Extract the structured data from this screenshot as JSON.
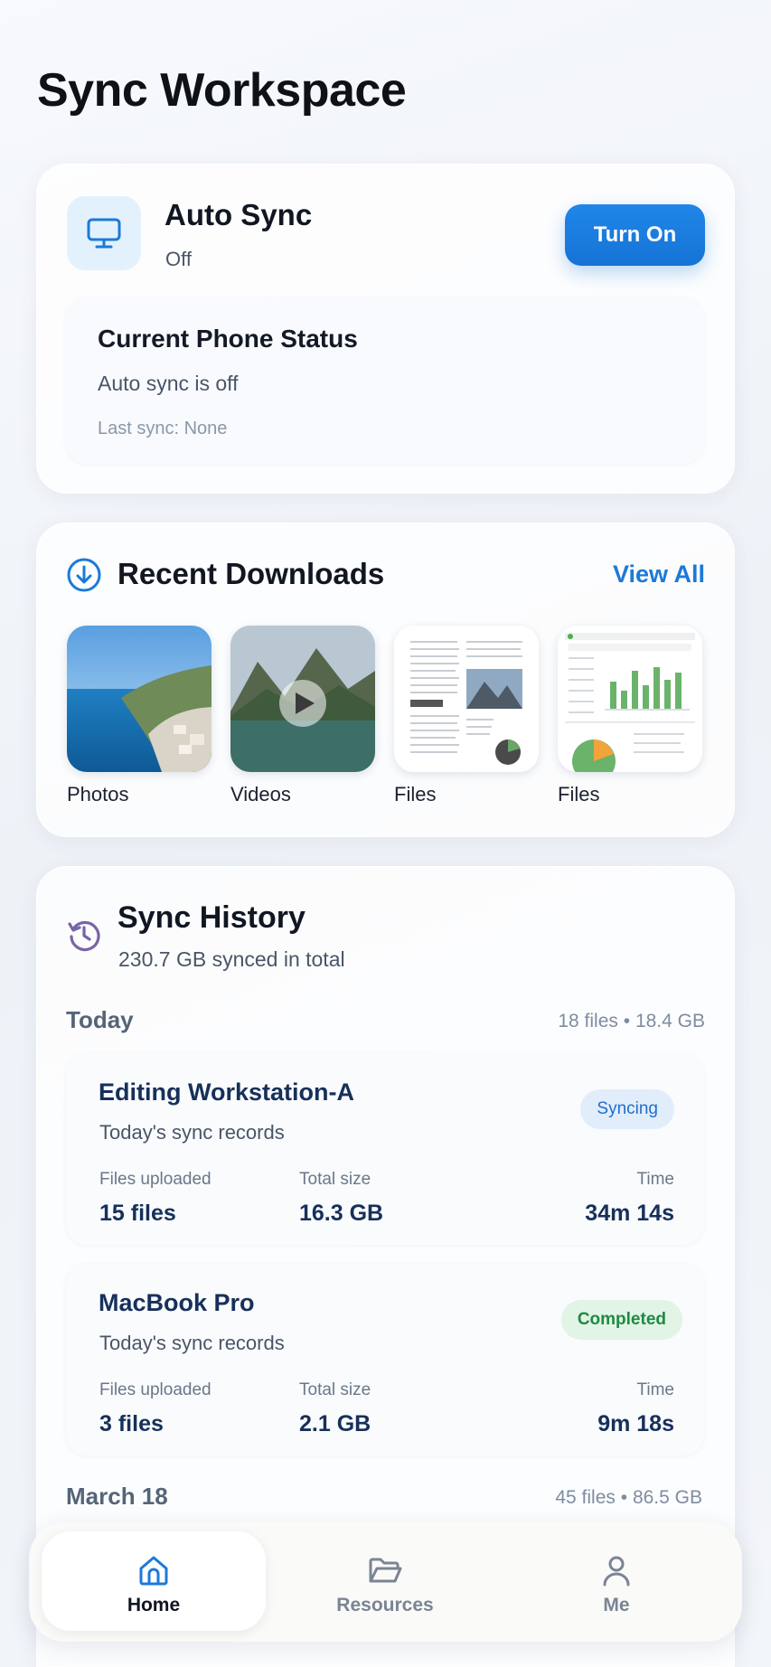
{
  "page": {
    "title": "Sync Workspace"
  },
  "auto_sync": {
    "title": "Auto Sync",
    "state": "Off",
    "button_label": "Turn On",
    "icon": "monitor-icon",
    "status": {
      "title": "Current Phone Status",
      "text": "Auto sync is off",
      "last_sync": "Last sync: None"
    }
  },
  "downloads": {
    "title": "Recent Downloads",
    "view_all": "View All",
    "items": [
      {
        "label": "Photos",
        "kind": "photo"
      },
      {
        "label": "Videos",
        "kind": "video"
      },
      {
        "label": "Files",
        "kind": "document"
      },
      {
        "label": "Files",
        "kind": "spreadsheet"
      }
    ]
  },
  "history": {
    "title": "Sync History",
    "total": "230.7 GB synced in total",
    "sections": [
      {
        "label": "Today",
        "files": "18 files",
        "size": "18.4 GB",
        "records": [
          {
            "device": "Editing Workstation-A",
            "subtitle": "Today's sync records",
            "badge": "Syncing",
            "files_label": "Files uploaded",
            "files_value": "15 files",
            "size_label": "Total size",
            "size_value": "16.3 GB",
            "time_label": "Time",
            "time_value": "34m 14s"
          },
          {
            "device": "MacBook Pro",
            "subtitle": "Today's sync records",
            "badge": "Completed",
            "files_label": "Files uploaded",
            "files_value": "3 files",
            "size_label": "Total size",
            "size_value": "2.1 GB",
            "time_label": "Time",
            "time_value": "9m 18s"
          }
        ]
      },
      {
        "label": "March 18",
        "files": "45 files",
        "size": "86.5 GB",
        "records": []
      }
    ]
  },
  "nav": {
    "items": [
      {
        "label": "Home",
        "icon": "home-icon",
        "active": true
      },
      {
        "label": "Resources",
        "icon": "folder-icon",
        "active": false
      },
      {
        "label": "Me",
        "icon": "person-icon",
        "active": false
      }
    ]
  },
  "colors": {
    "accent": "#1b7ad8",
    "syncing": "#1d6fce",
    "completed": "#1f8a43"
  }
}
